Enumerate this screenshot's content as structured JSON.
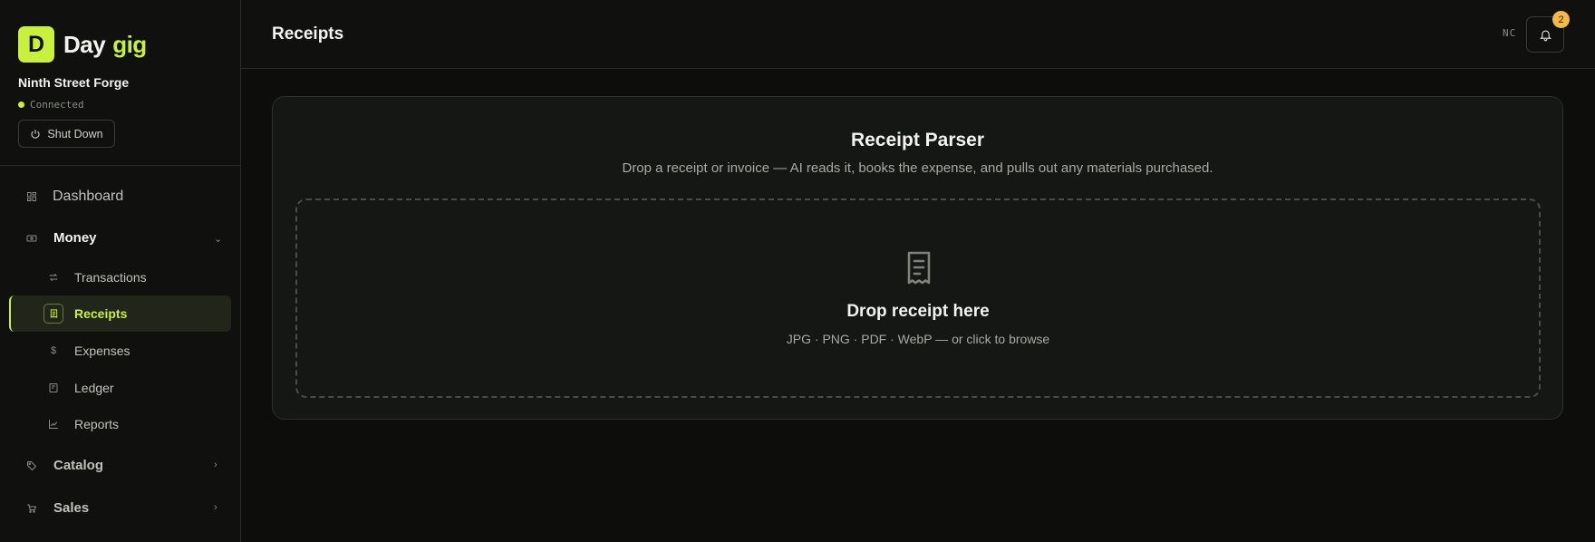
{
  "brand": {
    "logo_letter": "D",
    "name_part1": "Day",
    "name_part2": "gig"
  },
  "workspace": {
    "name": "Ninth Street Forge",
    "status": "Connected",
    "shutdown_label": "Shut Down"
  },
  "nav": {
    "dashboard": "Dashboard",
    "money": "Money",
    "money_items": [
      "Transactions",
      "Receipts",
      "Expenses",
      "Ledger",
      "Reports"
    ],
    "catalog": "Catalog",
    "sales": "Sales"
  },
  "header": {
    "title": "Receipts",
    "user_initials": "NC",
    "notification_count": "2"
  },
  "parser": {
    "title": "Receipt Parser",
    "subtitle": "Drop a receipt or invoice — AI reads it, books the expense, and pulls out any materials purchased.",
    "drop_title": "Drop receipt here",
    "drop_hint": "JPG · PNG · PDF · WebP — or click to browse"
  },
  "colors": {
    "accent": "#c9f03c",
    "badge": "#f5b94a",
    "background": "#0c0d0b"
  },
  "icons": {
    "dashboard": "dashboard-icon",
    "money": "money-icon",
    "transactions": "arrows-icon",
    "receipts": "receipt-icon",
    "expenses": "dollar-icon",
    "ledger": "book-icon",
    "reports": "chart-icon",
    "catalog": "tag-icon",
    "sales": "cart-icon",
    "power": "power-icon",
    "bell": "bell-icon"
  }
}
